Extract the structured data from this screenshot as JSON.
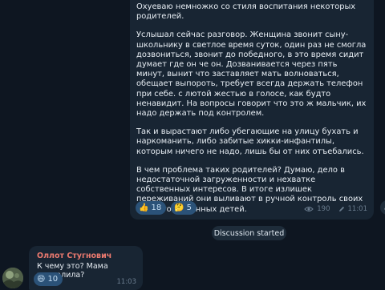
{
  "post": {
    "paragraphs": [
      "Охуеваю немножко со стиля воспитания некоторых родителей.",
      "Услышал сейчас разговор. Женщина звонит сыну-школьнику в светлое время суток, один раз не смогла дозвониться, звонит до победного, в это время сидит думает где он че он. Дозванивается через пять минут, вынит что заставляет мать волноваться, обещает выпороть, требует всегда держать телефон при себе. с лютой жестью в голосе, как будто ненавидит. На вопросы говорит что это ж мальчик, их надо держать под контролем.",
      "Так и вырастают либо убегающие на улицу бухать и наркоманить, либо забитые хикки-инфантилы, которым ничего не надо, лишь бы от них отъебались.",
      "В чем проблема таких родителей? Думаю, дело в недостаточной загруженности и нехватке собственных интересов. В итоге излишек переживаний они выливают в ручной контроль своих немногочисленных детей."
    ],
    "reactions": [
      {
        "emoji": "👍",
        "count": "18"
      },
      {
        "emoji": "🤔",
        "count": "5"
      }
    ],
    "views": "190",
    "time": "11:01"
  },
  "service": {
    "text": "Discussion started"
  },
  "reply": {
    "author": "Оллот Стугнович",
    "text": "К чему это? Мама пропалила?",
    "reaction": {
      "emoji": "😄",
      "count": "10"
    },
    "time": "11:03"
  },
  "colors": {
    "background": "#0e1621",
    "bubble": "#182533",
    "author": "#ec7a6f",
    "reaction_chip": "#2b5278"
  },
  "icons": [
    "eye-icon",
    "share-icon",
    "avatar"
  ]
}
